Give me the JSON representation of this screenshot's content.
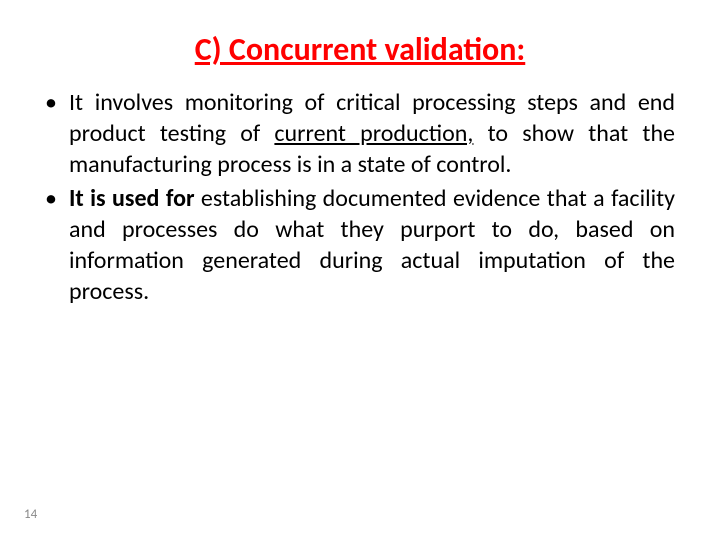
{
  "slide": {
    "title": "C) Concurrent validation:",
    "bullets": [
      {
        "prefix": "It involves monitoring of critical processing steps and end product testing of ",
        "underlined": "current production,",
        "suffix": " to show that the manufacturing process is in a state of control."
      },
      {
        "bold_prefix": "It is used for",
        "rest": " establishing documented evidence that a facility and processes do what they purport to do, based on information generated during actual imputation of the process."
      }
    ],
    "page_number": "14"
  }
}
